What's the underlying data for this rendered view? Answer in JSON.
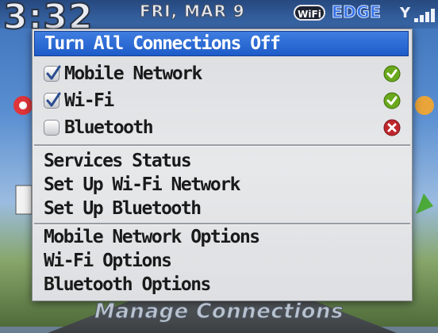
{
  "status_bar": {
    "time": "3:32",
    "date": "FRI, MAR 9",
    "wifi_badge": "WiFi",
    "network_type": "EDGE",
    "signal_glyph": "Y"
  },
  "menu": {
    "header": "Turn All Connections Off",
    "connections": [
      {
        "label": "Mobile Network",
        "checked": true,
        "status": "check-icon"
      },
      {
        "label": "Wi-Fi",
        "checked": true,
        "status": "check-icon"
      },
      {
        "label": "Bluetooth",
        "checked": false,
        "status": "x-icon"
      }
    ],
    "setup_items": [
      "Services Status",
      "Set Up Wi-Fi Network",
      "Set Up Bluetooth"
    ],
    "option_items": [
      "Mobile Network Options",
      "Wi-Fi Options",
      "Bluetooth Options"
    ]
  },
  "caption": "Manage Connections",
  "colors": {
    "selection": "#2a66d3",
    "status_ok": "#6aa81c",
    "status_off": "#c0262c"
  }
}
